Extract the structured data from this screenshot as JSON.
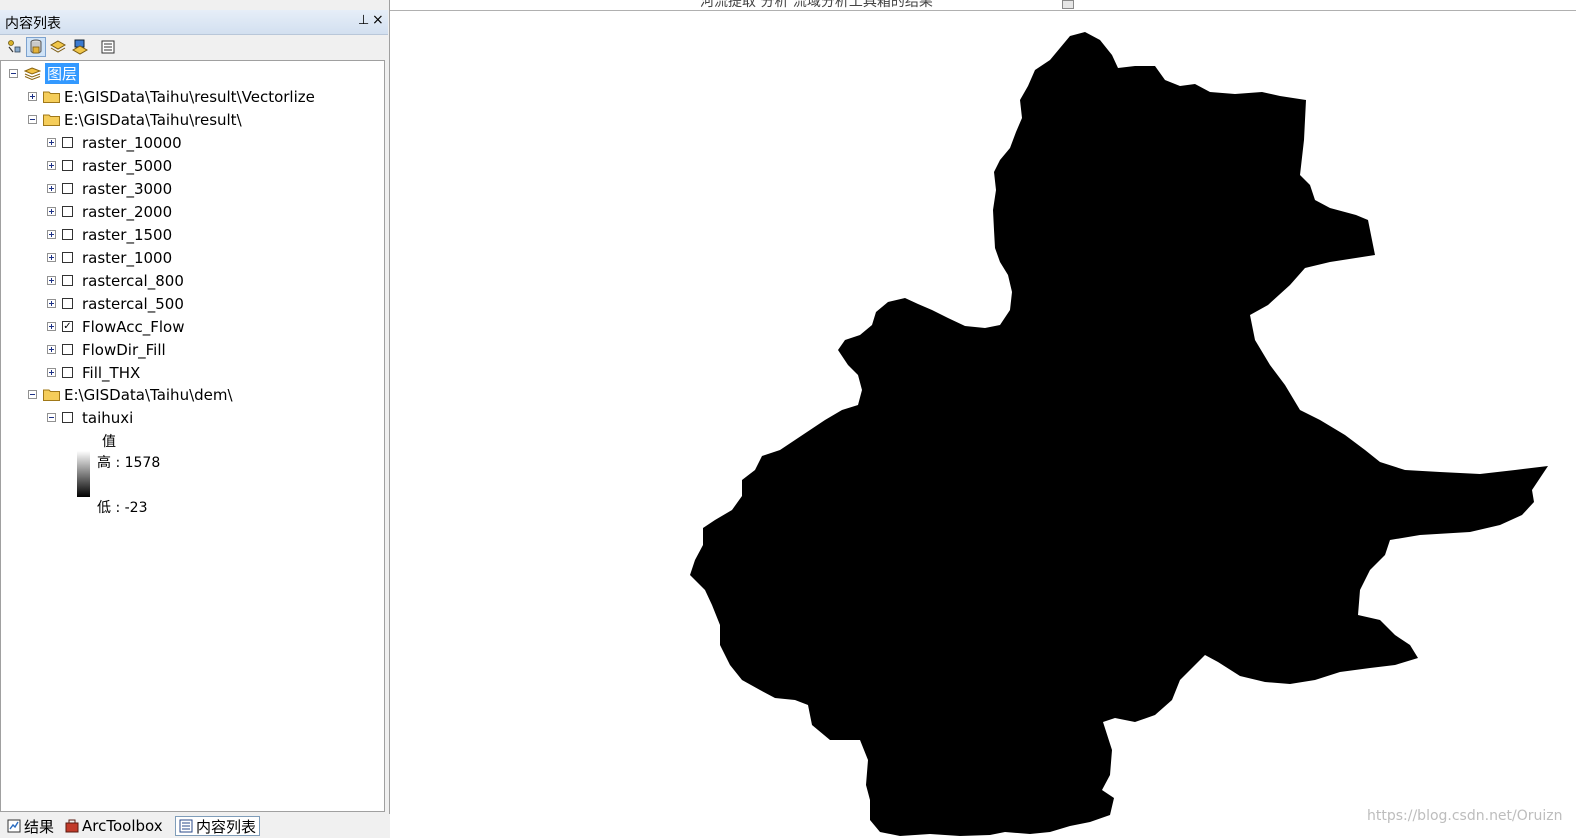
{
  "panel": {
    "title": "内容列表",
    "pin_glyph": "ᵖ",
    "close_glyph": "×"
  },
  "toolbar": {
    "buttons": [
      "list-by-drawing-order",
      "list-by-source",
      "list-by-visibility",
      "list-by-selection",
      "options"
    ],
    "active": "list-by-source"
  },
  "tree": {
    "root_label": "图层",
    "groups": [
      {
        "label": "E:\\GISData\\Taihu\\result\\Vectorlize",
        "expanded": false
      },
      {
        "label": "E:\\GISData\\Taihu\\result\\",
        "expanded": true,
        "layers": [
          {
            "label": "raster_10000",
            "checked": false
          },
          {
            "label": "raster_5000",
            "checked": false
          },
          {
            "label": "raster_3000",
            "checked": false
          },
          {
            "label": "raster_2000",
            "checked": false
          },
          {
            "label": "raster_1500",
            "checked": false
          },
          {
            "label": "raster_1000",
            "checked": false
          },
          {
            "label": "rastercal_800",
            "checked": false
          },
          {
            "label": "rastercal_500",
            "checked": false
          },
          {
            "label": "FlowAcc_Flow",
            "checked": true
          },
          {
            "label": "FlowDir_Fill",
            "checked": false
          },
          {
            "label": "Fill_THX",
            "checked": false
          }
        ]
      },
      {
        "label": "E:\\GISData\\Taihu\\dem\\",
        "expanded": true,
        "layers": [
          {
            "label": "taihuxi",
            "checked": false,
            "legend": {
              "field": "值",
              "high": "高 : 1578",
              "low": "低 : -23"
            }
          }
        ]
      }
    ]
  },
  "bottom_tabs": [
    {
      "label": "结果",
      "active": false
    },
    {
      "label": "ArcToolbox",
      "active": false
    },
    {
      "label": "内容列表",
      "active": true
    }
  ],
  "map": {
    "top_strip_text": "河流提取   分析   流域分析工具箱的结果",
    "watermark": "https://blog.csdn.net/Oruizn",
    "fill_color": "#000000"
  }
}
